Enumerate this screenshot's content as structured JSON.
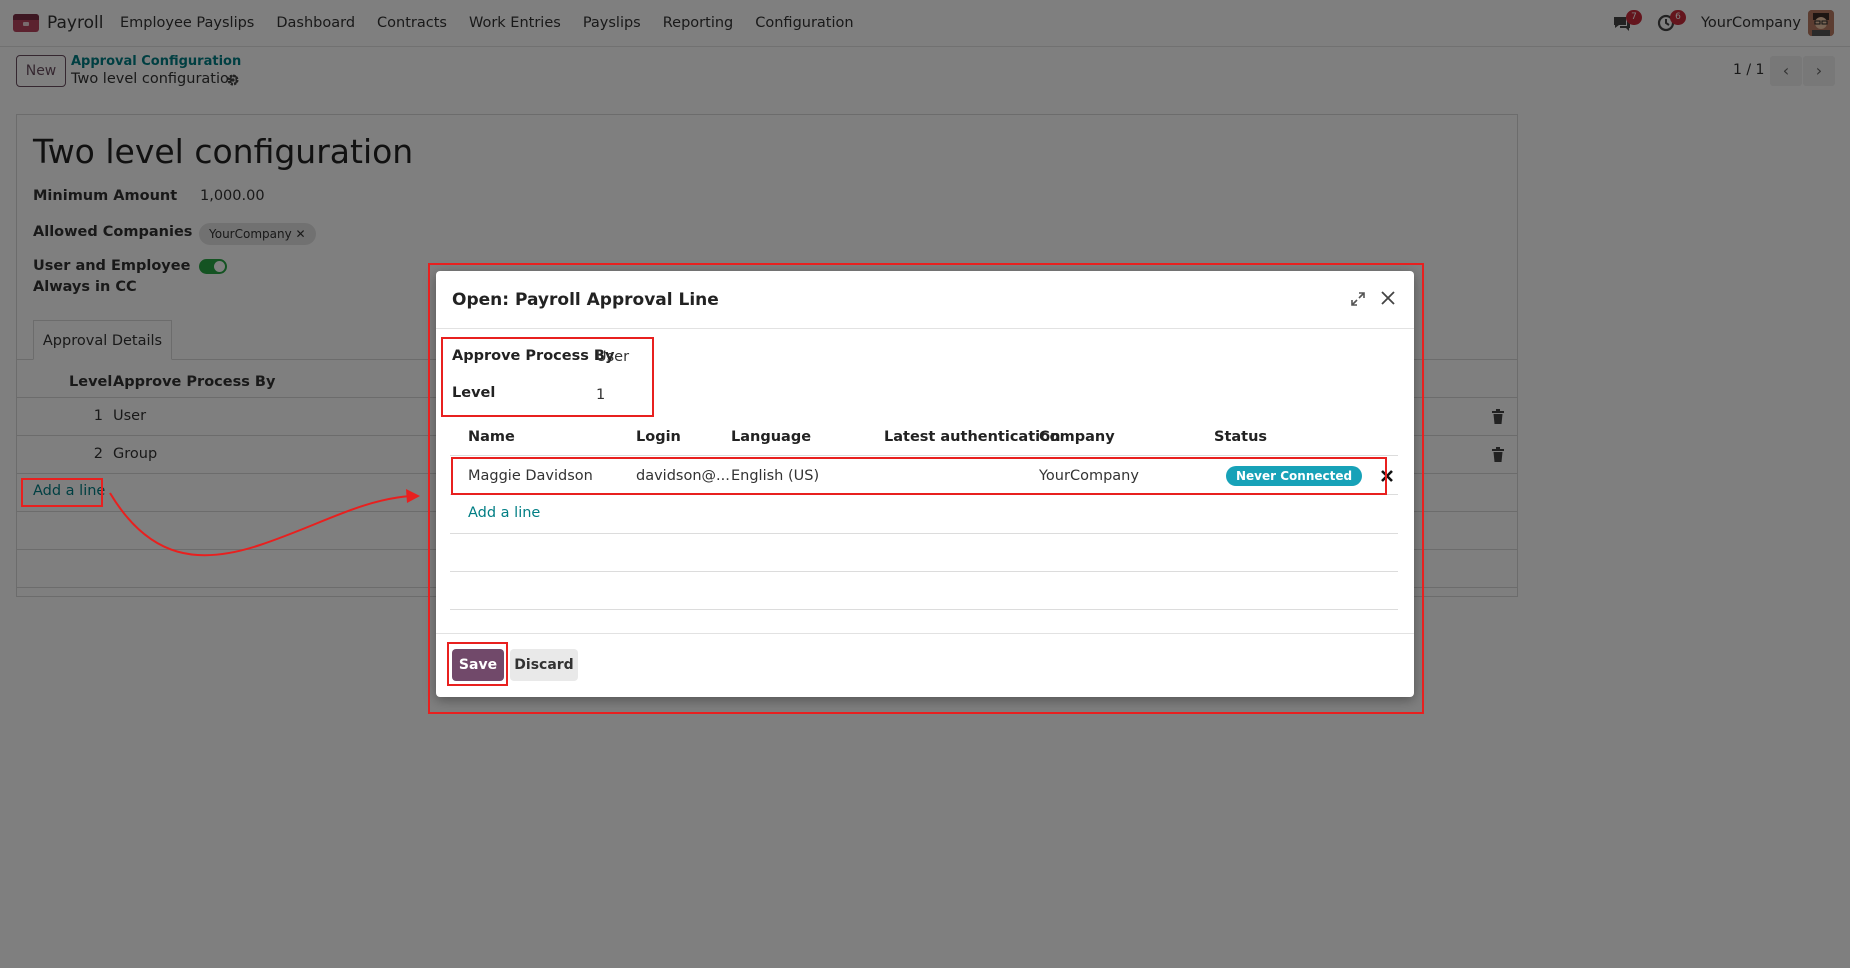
{
  "navbar": {
    "app_name": "Payroll",
    "menu": [
      "Employee Payslips",
      "Dashboard",
      "Contracts",
      "Work Entries",
      "Payslips",
      "Reporting",
      "Configuration"
    ],
    "chat_badge": "7",
    "activity_badge": "6",
    "company": "YourCompany"
  },
  "control_panel": {
    "new_label": "New",
    "breadcrumb_parent": "Approval Configuration",
    "breadcrumb_current": "Two level configuration",
    "pager": "1 / 1"
  },
  "form": {
    "title": "Two level configuration",
    "minimum_amount_label": "Minimum Amount",
    "minimum_amount_value": "1,000.00",
    "allowed_companies_label": "Allowed Companies",
    "allowed_companies_tag": "YourCompany ✕",
    "cc_label_line1": "User and Employee",
    "cc_label_line2": "Always in CC",
    "cc_enabled": true,
    "tab_label": "Approval Details",
    "columns": {
      "level": "Level",
      "approve": "Approve Process By"
    },
    "rows": [
      {
        "level": "1",
        "approve": "User"
      },
      {
        "level": "2",
        "approve": "Group"
      }
    ],
    "add_line": "Add a line"
  },
  "modal": {
    "title": "Open: Payroll Approval Line",
    "approve_label": "Approve Process By",
    "approve_value": "User",
    "level_label": "Level",
    "level_value": "1",
    "columns": [
      "Name",
      "Login",
      "Language",
      "Latest authentication",
      "Company",
      "Status"
    ],
    "user_row": {
      "name": "Maggie Davidson",
      "login": "davidson@...",
      "language": "English (US)",
      "latest_auth": "",
      "company": "YourCompany",
      "status": "Never Connected"
    },
    "add_line": "Add a line",
    "save_label": "Save",
    "discard_label": "Discard"
  },
  "colors": {
    "brand": "#71496a",
    "link": "#017e84",
    "status_badge": "#17a2b8",
    "annotation": "#e8201f",
    "toggle_on": "#28a745"
  }
}
